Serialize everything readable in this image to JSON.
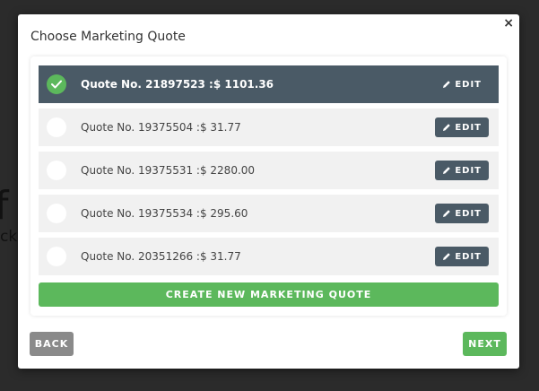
{
  "background": {
    "large_text": "f",
    "small_text": "ck"
  },
  "modal": {
    "title": "Choose Marketing Quote",
    "close_label": "×",
    "quotes": [
      {
        "label": "Quote No. 21897523 :$ 1101.36",
        "selected": true,
        "edit_label": "EDIT"
      },
      {
        "label": "Quote No. 19375504 :$ 31.77",
        "selected": false,
        "edit_label": "EDIT"
      },
      {
        "label": "Quote No. 19375531 :$ 2280.00",
        "selected": false,
        "edit_label": "EDIT"
      },
      {
        "label": "Quote No. 19375534 :$ 295.60",
        "selected": false,
        "edit_label": "EDIT"
      },
      {
        "label": "Quote No. 20351266 :$ 31.77",
        "selected": false,
        "edit_label": "EDIT"
      }
    ],
    "create_label": "CREATE NEW MARKETING QUOTE",
    "back_label": "BACK",
    "next_label": "NEXT"
  },
  "colors": {
    "accent_green": "#5cb85c",
    "selected_row": "#4a5a66",
    "row_bg": "#f1f1f1",
    "back_gray": "#8a8a8a"
  },
  "icons": {
    "radio_checked": "check-icon",
    "edit": "pencil-icon",
    "close": "close-icon"
  }
}
